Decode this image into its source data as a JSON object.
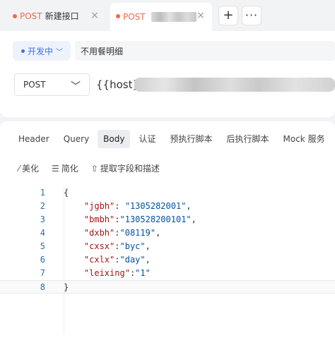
{
  "tabs": [
    {
      "method": "POST",
      "name": "新建接口",
      "close": "×",
      "active": false
    },
    {
      "method": "POST",
      "name": "",
      "close": "×",
      "active": true
    }
  ],
  "tabbar": {
    "add_label": "+",
    "more_label": "···"
  },
  "request": {
    "env_label": "开发中",
    "description": "不用餐明细",
    "method": "POST",
    "url_prefix": "{{host}}"
  },
  "subtabs": [
    "Header",
    "Query",
    "Body",
    "认证",
    "预执行脚本",
    "后执行脚本",
    "Mock 服务"
  ],
  "active_subtab": "Body",
  "actions": [
    {
      "icon": "magic-wand-icon",
      "label": "美化"
    },
    {
      "icon": "list-compact-icon",
      "label": "简化"
    },
    {
      "icon": "upload-icon",
      "label": "提取字段和描述"
    }
  ],
  "code_lines": [
    {
      "n": "1",
      "parts": [
        {
          "t": "p",
          "v": "{"
        }
      ]
    },
    {
      "n": "2",
      "parts": [
        {
          "t": "p",
          "v": "    "
        },
        {
          "t": "k",
          "v": "\"jgbh\""
        },
        {
          "t": "p",
          "v": ": "
        },
        {
          "t": "s",
          "v": "\"1305282001\""
        },
        {
          "t": "p",
          "v": ","
        }
      ]
    },
    {
      "n": "3",
      "parts": [
        {
          "t": "p",
          "v": "    "
        },
        {
          "t": "k",
          "v": "\"bmbh\""
        },
        {
          "t": "p",
          "v": ":"
        },
        {
          "t": "s",
          "v": "\"130528200101\""
        },
        {
          "t": "p",
          "v": ","
        }
      ]
    },
    {
      "n": "4",
      "parts": [
        {
          "t": "p",
          "v": "    "
        },
        {
          "t": "k",
          "v": "\"dxbh\""
        },
        {
          "t": "p",
          "v": ":"
        },
        {
          "t": "s",
          "v": "\"08119\""
        },
        {
          "t": "p",
          "v": ","
        }
      ]
    },
    {
      "n": "5",
      "parts": [
        {
          "t": "p",
          "v": "    "
        },
        {
          "t": "k",
          "v": "\"cxsx\""
        },
        {
          "t": "p",
          "v": ":"
        },
        {
          "t": "s",
          "v": "\"byc\""
        },
        {
          "t": "p",
          "v": ","
        }
      ]
    },
    {
      "n": "6",
      "parts": [
        {
          "t": "p",
          "v": "    "
        },
        {
          "t": "k",
          "v": "\"cxlx\""
        },
        {
          "t": "p",
          "v": ":"
        },
        {
          "t": "s",
          "v": "\"day\""
        },
        {
          "t": "p",
          "v": ","
        }
      ]
    },
    {
      "n": "7",
      "parts": [
        {
          "t": "p",
          "v": "    "
        },
        {
          "t": "k",
          "v": "\"leixing\""
        },
        {
          "t": "p",
          "v": ":"
        },
        {
          "t": "s",
          "v": "\"1\""
        }
      ]
    },
    {
      "n": "8",
      "parts": [
        {
          "t": "p",
          "v": "}"
        }
      ]
    }
  ],
  "colors": {
    "accent": "#3b73e0",
    "method_post": "#f06a4e",
    "json_key": "#a31515",
    "json_string": "#0451a5"
  }
}
